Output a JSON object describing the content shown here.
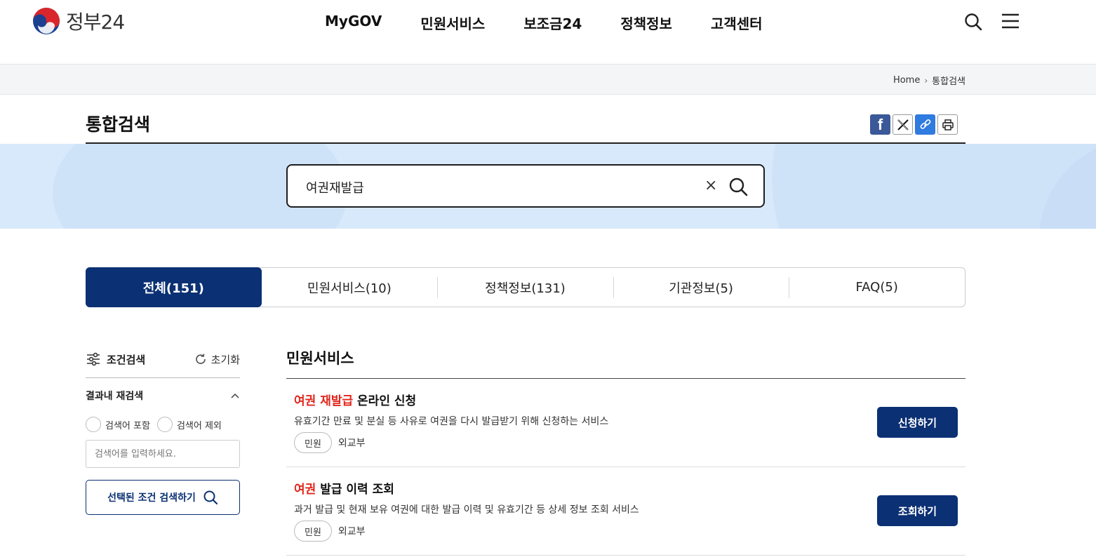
{
  "header": {
    "logo_text": "정부24",
    "nav": [
      "MyGOV",
      "민원서비스",
      "보조금24",
      "정책정보",
      "고객센터"
    ]
  },
  "breadcrumb": {
    "home": "Home",
    "current": "통합검색"
  },
  "page": {
    "title": "통합검색"
  },
  "search": {
    "value": "여권재발급",
    "clear_label": "×"
  },
  "tabs": [
    "전체(151)",
    "민원서비스(10)",
    "정책정보(131)",
    "기관정보(5)",
    "FAQ(5)"
  ],
  "sidebar": {
    "title": "조건검색",
    "reset": "초기화",
    "sub_title": "결과내 재검색",
    "radio_include": "검색어 포함",
    "radio_exclude": "검색어 제외",
    "input_placeholder": "검색어를 입력하세요.",
    "submit": "선택된 조건 검색하기"
  },
  "results": {
    "section_title": "민원서비스",
    "items": [
      {
        "title_highlight": "여권 재발급",
        "title_rest": " 온라인 신청",
        "desc": "유효기간 만료 및 분실 등 사유로 여권을 다시 발급받기 위해 신청하는 서비스",
        "badge": "민원",
        "agency": "외교부",
        "button": "신청하기"
      },
      {
        "title_highlight": "여권",
        "title_rest": " 발급 이력 조회",
        "desc": "과거 발급 및 현재 보유 여권에 대한 발급 이력 및 유효기간 등 상세 정보 조회 서비스",
        "badge": "민원",
        "agency": "외교부",
        "button": "조회하기"
      }
    ]
  },
  "colors": {
    "primary": "#0b3073",
    "highlight": "#e1261c",
    "search_band": "#d8e9fb"
  }
}
